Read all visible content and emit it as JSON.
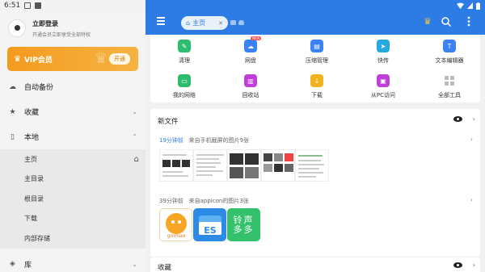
{
  "status": {
    "time": "6:51"
  },
  "user": {
    "name": "立即登录",
    "sub": "开通会员立即享受全部特权"
  },
  "vip": {
    "label": "VIP会员",
    "button": "开通"
  },
  "nav": {
    "backup": "自动备份",
    "favorites": "收藏",
    "local": "本地",
    "library": "库"
  },
  "local_items": [
    "主页",
    "主目录",
    "根目录",
    "下载",
    "内部存储"
  ],
  "appbar": {
    "tab_label": "主页"
  },
  "tools": {
    "row1": [
      {
        "label": "清理",
        "icon": "broom-icon",
        "color": "#2dbd6e"
      },
      {
        "label": "网盘",
        "icon": "cloud-icon",
        "color": "#3b82f6",
        "badge": "NEW"
      },
      {
        "label": "压缩管理",
        "icon": "zip-icon",
        "color": "#3b82f6"
      },
      {
        "label": "快传",
        "icon": "paper-plane-icon",
        "color": "#29a8e0"
      },
      {
        "label": "文本编辑器",
        "icon": "text-editor-icon",
        "color": "#3b82f6"
      }
    ],
    "row2": [
      {
        "label": "我的网络",
        "icon": "router-icon",
        "color": "#2dbd6e"
      },
      {
        "label": "回收站",
        "icon": "trash-icon",
        "color": "#c03fd8"
      },
      {
        "label": "下载",
        "icon": "download-icon",
        "color": "#f3b21b"
      },
      {
        "label": "从PC访问",
        "icon": "monitor-icon",
        "color": "#c03fd8"
      },
      {
        "label": "全部工具",
        "icon": "grid-icon",
        "color": "#bbbbbb"
      }
    ]
  },
  "new_files": {
    "title": "新文件",
    "group1": {
      "time": "19分钟前",
      "desc": "来自手机截屏的图片9张"
    },
    "group2": {
      "time": "39分钟前",
      "desc": "来自appicon的图片3张"
    },
    "app_tiles": [
      {
        "name": "gmmao-app-icon",
        "color": "#f6a623",
        "text": "gmmao"
      },
      {
        "name": "es-file-explorer-icon",
        "color": "#2d8be6",
        "text": "ES"
      },
      {
        "name": "lingsheng-duoduo-icon",
        "color": "#33c26b",
        "text": "铃声多多"
      }
    ]
  },
  "favorites": {
    "title": "收藏"
  }
}
